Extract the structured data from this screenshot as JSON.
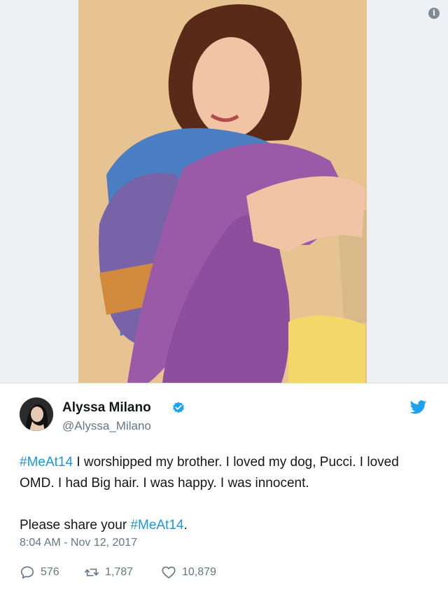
{
  "tweet": {
    "author_name": "Alyssa Milano",
    "handle": "@Alyssa_Milano",
    "text_line1_hashtag": "#MeAt14",
    "text_line1_rest": " I worshipped my brother. I loved my dog, Pucci. I loved OMD. I had Big hair. I was happy. I was innocent.",
    "text_line2_prefix": "Please share your ",
    "text_line2_hashtag": "#MeAt14",
    "text_line2_suffix": ".",
    "timestamp": "8:04 AM - Nov 12, 2017"
  },
  "actions": {
    "replies": "576",
    "retweets": "1,787",
    "likes": "10,879"
  },
  "icons": {
    "info": "info-icon",
    "verified": "verified-badge-icon",
    "bird": "twitter-bird-icon",
    "reply": "reply-icon",
    "retweet": "retweet-icon",
    "like": "heart-icon"
  },
  "colors": {
    "hashtag": "#1b95e0",
    "verified": "#1da1f2",
    "secondary_text": "#657786",
    "photo_background": "#e5bf8a"
  }
}
